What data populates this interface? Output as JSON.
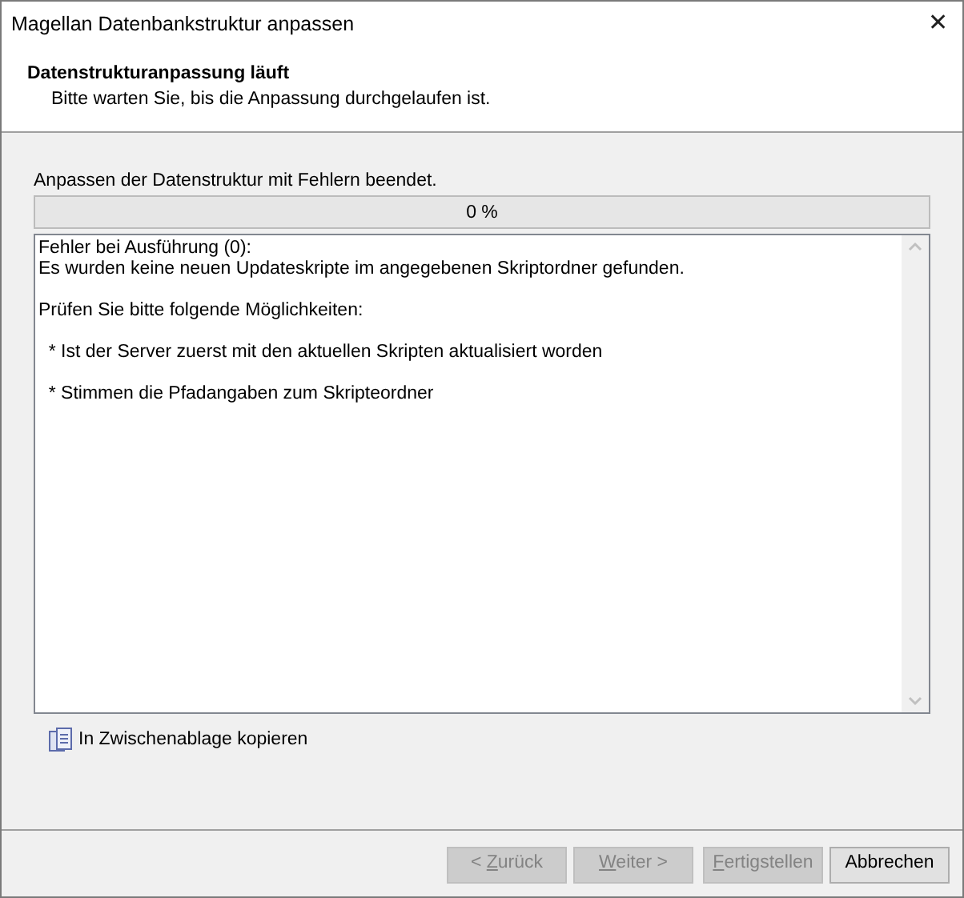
{
  "window": {
    "title": "Magellan Datenbankstruktur anpassen",
    "close": "✕"
  },
  "header": {
    "title": "Datenstrukturanpassung läuft",
    "subtitle": "Bitte warten Sie, bis die Anpassung durchgelaufen ist."
  },
  "status": "Anpassen der Datenstruktur mit Fehlern beendet.",
  "progress": {
    "level": 0,
    "reading": "0 %"
  },
  "log": [
    [
      "Fehler bei Ausführung (0):",
      "Es wurden keine neuen Updateskripte im angegebenen Skriptordner gefunden."
    ],
    [
      "Prüfen Sie bitte folgende Möglichkeiten:"
    ],
    [
      "  * Ist der Server zuerst mit den aktuellen Skripten aktualisiert worden"
    ],
    [
      "  * Stimmen die Pfadangaben zum Skripteordner"
    ]
  ],
  "copy_link": "In Zwischenablage kopieren",
  "buttons": [
    {
      "label_before": "< ",
      "access_key": "Z",
      "label_after": "urück",
      "disabled": true
    },
    {
      "access_key": "W",
      "label_after": "eiter >",
      "disabled": true
    },
    {
      "access_key": "F",
      "label_after": "ertigstellen",
      "disabled": true
    },
    {
      "label": "Abbrechen",
      "disabled": false
    }
  ]
}
